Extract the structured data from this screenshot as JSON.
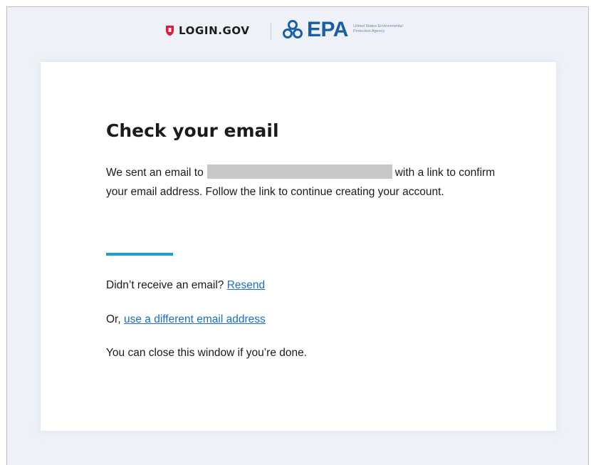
{
  "header": {
    "login_logo_text": "LOGIN.GOV",
    "epa_logo_text": "EPA",
    "epa_agency_text": "United States Environmental Protection Agency"
  },
  "main": {
    "title": "Check your email",
    "intro_before": "We sent an email to",
    "intro_after": "with a link to confirm your email address. Follow the link to continue creating your account.",
    "resend_prefix": "Didn’t receive an email?",
    "resend_link": "Resend",
    "different_prefix": "Or,",
    "different_link": "use a different email address",
    "close_text": "You can close this window if you’re done."
  },
  "colors": {
    "accent": "#1a9fd6",
    "link": "#1a6ec7",
    "login_red": "#e21c3d",
    "epa_blue": "#1a5ea8",
    "page_background": "#eef2f8"
  },
  "icons": {
    "login": "shield-icon",
    "epa": "epa-flower-icon"
  }
}
